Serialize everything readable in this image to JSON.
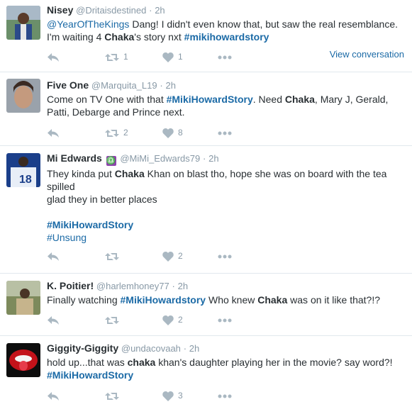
{
  "tweets": [
    {
      "name": "Nisey",
      "handle": "@Dritaisdestined",
      "sep": "·",
      "time": "2h",
      "line1": {
        "mention": "@YearOfTheKings",
        "rest": " Dang! I didn't even know that, but saw the real resemblance."
      },
      "line2": {
        "pre": "I'm waiting 4 ",
        "bold": "Chaka",
        "mid": "'s story nxt ",
        "hashtag": "#mikihowardstory"
      },
      "retweets": "1",
      "likes": "1",
      "view_conversation": "View conversation"
    },
    {
      "name": "Five One",
      "handle": "@Marquita_L19",
      "sep": "·",
      "time": "2h",
      "line1": {
        "pre": "Come on TV One with that ",
        "hashtag": "#MikiHowardStory",
        "mid": ". Need ",
        "bold": "Chaka",
        "rest": ", Mary J, Gerald,"
      },
      "line2": "Patti, Debarge and Prince next.",
      "retweets": "2",
      "likes": "8"
    },
    {
      "name": "Mi Edwards",
      "badge": "♎",
      "handle": "@MiMi_Edwards79",
      "sep": "·",
      "time": "2h",
      "line1": {
        "pre": "They kinda put ",
        "bold": "Chaka",
        "rest": " Khan on blast tho,  hope she was on board with the tea"
      },
      "line2": "spilled",
      "line3": "glad they in better places",
      "hashtag1": "#MikiHowardStory",
      "hashtag2": "#Unsung",
      "likes": "2"
    },
    {
      "name": "K. Poitier!",
      "handle": "@harlemhoney77",
      "sep": "·",
      "time": "2h",
      "line1": {
        "pre": "Finally watching ",
        "hashtag": "#MikiHowardstory",
        "mid": " Who knew ",
        "bold": "Chaka",
        "rest": " was on it like that?!?"
      },
      "likes": "2"
    },
    {
      "name": "Giggity-Giggity",
      "handle": "@undacovaah",
      "sep": "·",
      "time": "2h",
      "line1": {
        "pre": "hold up...that was ",
        "bold": "chaka",
        "rest": " khan's daughter playing her in the movie? say word?!"
      },
      "hashtag": "#MikiHowardStory",
      "likes": "3"
    }
  ]
}
